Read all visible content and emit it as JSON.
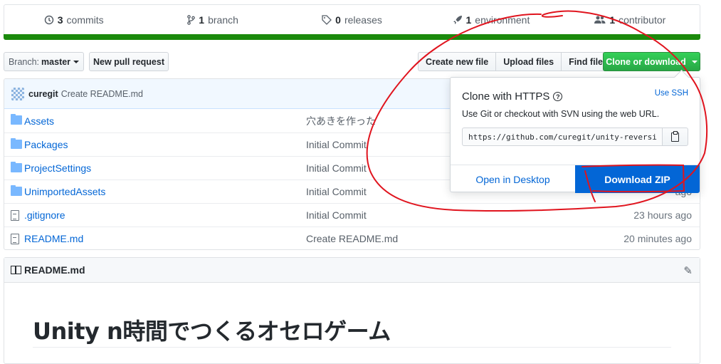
{
  "summary": {
    "commits_count": "3",
    "commits_label": "commits",
    "branch_count": "1",
    "branch_label": "branch",
    "releases_count": "0",
    "releases_label": "releases",
    "environment_count": "1",
    "environment_label": "environment",
    "contributor_count": "1",
    "contributor_label": "contributor"
  },
  "lang_bar_color": "#1b8a0c",
  "toolbar": {
    "branch_prefix": "Branch:",
    "branch_value": "master",
    "new_pull_request": "New pull request",
    "create_new_file": "Create new file",
    "upload_files": "Upload files",
    "find_file": "Find file",
    "clone_or_download": "Clone or download"
  },
  "latest_commit": {
    "author": "curegit",
    "message": "Create README.md"
  },
  "files": [
    {
      "icon": "folder-icon",
      "name": "Assets",
      "message": "穴あきを作った",
      "age": ""
    },
    {
      "icon": "folder-icon",
      "name": "Packages",
      "message": "Initial Commit",
      "age": ""
    },
    {
      "icon": "folder-icon",
      "name": "ProjectSettings",
      "message": "Initial Commit",
      "age": ""
    },
    {
      "icon": "folder-icon",
      "name": "UnimportedAssets",
      "message": "Initial Commit",
      "age": "ago"
    },
    {
      "icon": "file-icon",
      "name": ".gitignore",
      "message": "Initial Commit",
      "age": "23 hours ago"
    },
    {
      "icon": "file-icon",
      "name": "README.md",
      "message": "Create README.md",
      "age": "20 minutes ago"
    }
  ],
  "readme": {
    "header": "README.md",
    "title": "Unity n時間でつくるオセロゲーム"
  },
  "clone_popup": {
    "title": "Clone with HTTPS",
    "use_ssh": "Use SSH",
    "description": "Use Git or checkout with SVN using the web URL.",
    "url": "https://github.com/curegit/unity-reversi",
    "open_in_desktop": "Open in Desktop",
    "download_zip": "Download ZIP"
  },
  "annotation_color": "#e0141e"
}
